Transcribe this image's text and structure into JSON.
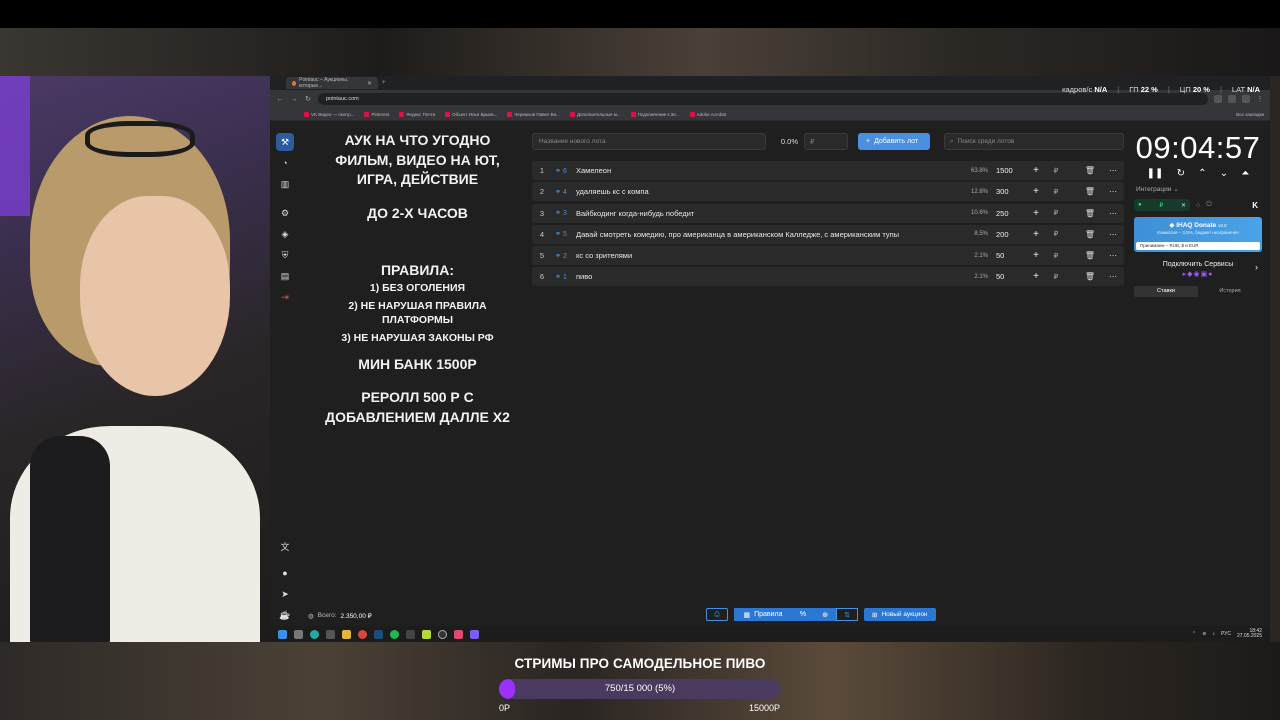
{
  "browser": {
    "tab_title": "Pointauc – Аукционы, которые...",
    "url": "pointauc.com",
    "bookmarks": [
      "VK Видео — смотр...",
      "Pinterest",
      "Яндекс Почта",
      "Объект Илья Брыкв...",
      "Черемхов Павел Ви...",
      "Дополнительные м...",
      "Подключение к Зе...",
      "Adobe Acrobat"
    ],
    "all_bookmarks": "Все закладки"
  },
  "stats": {
    "fps_label": "кадров/с",
    "fps_value": "N/A",
    "gpu_label": "ГП",
    "gpu_value": "22 %",
    "cpu_label": "ЦП",
    "cpu_value": "20 %",
    "lat_label": "LAT",
    "lat_value": "N/A"
  },
  "rules": {
    "line1": "АУК НА ЧТО УГОДНО",
    "line2": "ФИЛЬМ, ВИДЕО НА ЮТ,",
    "line3": "ИГРА, ДЕЙСТВИЕ",
    "line4": "ДО 2-Х ЧАСОВ",
    "heading": "ПРАВИЛА:",
    "rule1": "1) БЕЗ ОГОЛЕНИЯ",
    "rule2a": "2) НЕ НАРУШАЯ ПРАВИЛА",
    "rule2b": "ПЛАТФОРМЫ",
    "rule3": "3) НЕ НАРУШАЯ ЗАКОНЫ РФ",
    "min_bank": "МИН БАНК 1500Р",
    "reroll1": "РЕРОЛЛ 500 Р С",
    "reroll2": "ДОБАВЛЕНИЕМ ДАЛЛЕ Х2"
  },
  "controls": {
    "lot_placeholder": "Название нового лота",
    "percent": "0.0%",
    "amount_placeholder": "₽",
    "add_lot": "Добавить лот",
    "search_placeholder": "Поиск среди лотов"
  },
  "lots": [
    {
      "idx": "1",
      "fav": "6",
      "name": "Хамелеон",
      "pct": "63.8%",
      "amount": "1500"
    },
    {
      "idx": "2",
      "fav": "4",
      "name": "удаляешь кс с компа",
      "pct": "12.8%",
      "amount": "300"
    },
    {
      "idx": "3",
      "fav": "3",
      "name": "Вайбкодинг когда-нибудь победит",
      "pct": "10.6%",
      "amount": "250"
    },
    {
      "idx": "4",
      "fav": "5",
      "name": "Давай смотреть комедию, про американца в американском Калледже, с американским тупы",
      "pct": "8.5%",
      "amount": "200"
    },
    {
      "idx": "5",
      "fav": "2",
      "name": "кс со зрителями",
      "pct": "2.1%",
      "amount": "50"
    },
    {
      "idx": "6",
      "fav": "1",
      "name": "пиво",
      "pct": "2.1%",
      "amount": "50"
    }
  ],
  "lot_currency": "₽",
  "timer": {
    "value": "09:04:57"
  },
  "integrations": {
    "label": "Интеграции",
    "chip": "₽",
    "donate_title": "IHAQ Donate",
    "donate_version": "v2.0",
    "donate_sub": "Комиссия – 3,5%, бюджет неограничен",
    "donate_accept": "Принимаем – RUB, $ и EUR",
    "connect": "Подключить Сервисы",
    "tab_bets": "Ставки",
    "tab_history": "История"
  },
  "bottom": {
    "total_label": "Всего:",
    "total_value": "2.350,00 ₽",
    "rules_btn": "Правила",
    "new_auction": "Новый аукцион"
  },
  "taskbar": {
    "lang": "РУС",
    "time": "18:42",
    "date": "27.05.2025"
  },
  "overlay": {
    "title": "СТРИМЫ ПРО САМОДЕЛЬНОЕ ПИВО",
    "progress_text": "750/15 000 (5%)",
    "progress_fraction": 0.05,
    "min_label": "0Р",
    "max_label": "15000Р",
    "accent": "#9b30ff"
  }
}
